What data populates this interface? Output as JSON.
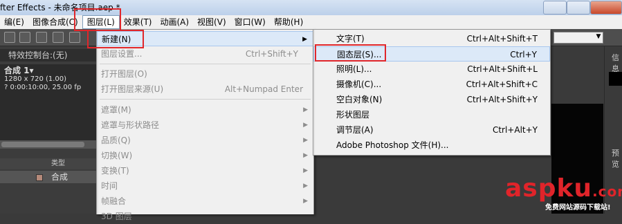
{
  "title_bar": {
    "text": "fter Effects - 未命名项目.aep *"
  },
  "menubar": {
    "items": [
      {
        "label": "编(E)"
      },
      {
        "label": "图像合成(C)"
      },
      {
        "label": "图层(L)"
      },
      {
        "label": "效果(T)"
      },
      {
        "label": "动画(A)"
      },
      {
        "label": "视图(V)"
      },
      {
        "label": "窗口(W)"
      },
      {
        "label": "帮助(H)"
      }
    ],
    "active_index": 2
  },
  "left_panel": {
    "effect_tab": "特效控制台:(无)",
    "comp_name": "合成 1▾",
    "comp_size": "1280 x 720 (1.00)",
    "comp_duration": "? 0:00:10:00, 25.00 fp",
    "list_header": "类型",
    "list_row_label": "合成"
  },
  "right_panel": {
    "info_label": "信息",
    "preview_label": "预览"
  },
  "layer_menu": {
    "items": [
      {
        "label": "新建(N)",
        "shortcut": "",
        "submenu": true,
        "disabled": false
      },
      {
        "label": "图层设置...",
        "shortcut": "Ctrl+Shift+Y",
        "submenu": false,
        "disabled": true
      },
      {
        "label": "打开图层(O)",
        "shortcut": "",
        "submenu": false,
        "disabled": true
      },
      {
        "label": "打开图层来源(U)",
        "shortcut": "Alt+Numpad Enter",
        "submenu": false,
        "disabled": true
      },
      {
        "label": "遮罩(M)",
        "shortcut": "",
        "submenu": true,
        "disabled": true
      },
      {
        "label": "遮罩与形状路径",
        "shortcut": "",
        "submenu": true,
        "disabled": true
      },
      {
        "label": "品质(Q)",
        "shortcut": "",
        "submenu": true,
        "disabled": true
      },
      {
        "label": "切换(W)",
        "shortcut": "",
        "submenu": true,
        "disabled": true
      },
      {
        "label": "变换(T)",
        "shortcut": "",
        "submenu": true,
        "disabled": true
      },
      {
        "label": "时间",
        "shortcut": "",
        "submenu": true,
        "disabled": true
      },
      {
        "label": "帧融合",
        "shortcut": "",
        "submenu": true,
        "disabled": true
      },
      {
        "label": "3D 图层",
        "shortcut": "",
        "submenu": false,
        "disabled": true
      }
    ]
  },
  "new_menu": {
    "items": [
      {
        "label": "文字(T)",
        "shortcut": "Ctrl+Alt+Shift+T"
      },
      {
        "label": "固态层(S)...",
        "shortcut": "Ctrl+Y"
      },
      {
        "label": "照明(L)...",
        "shortcut": "Ctrl+Alt+Shift+L"
      },
      {
        "label": "摄像机(C)...",
        "shortcut": "Ctrl+Alt+Shift+C"
      },
      {
        "label": "空白对象(N)",
        "shortcut": "Ctrl+Alt+Shift+Y"
      },
      {
        "label": "形状图层",
        "shortcut": ""
      },
      {
        "label": "调节层(A)",
        "shortcut": "Ctrl+Alt+Y"
      },
      {
        "label": "Adobe Photoshop 文件(H)...",
        "shortcut": ""
      }
    ],
    "highlighted_index": 1
  },
  "watermark": {
    "text": "aspku",
    "dotcom": ".com",
    "subtitle": "免费网站源码下载站!"
  }
}
